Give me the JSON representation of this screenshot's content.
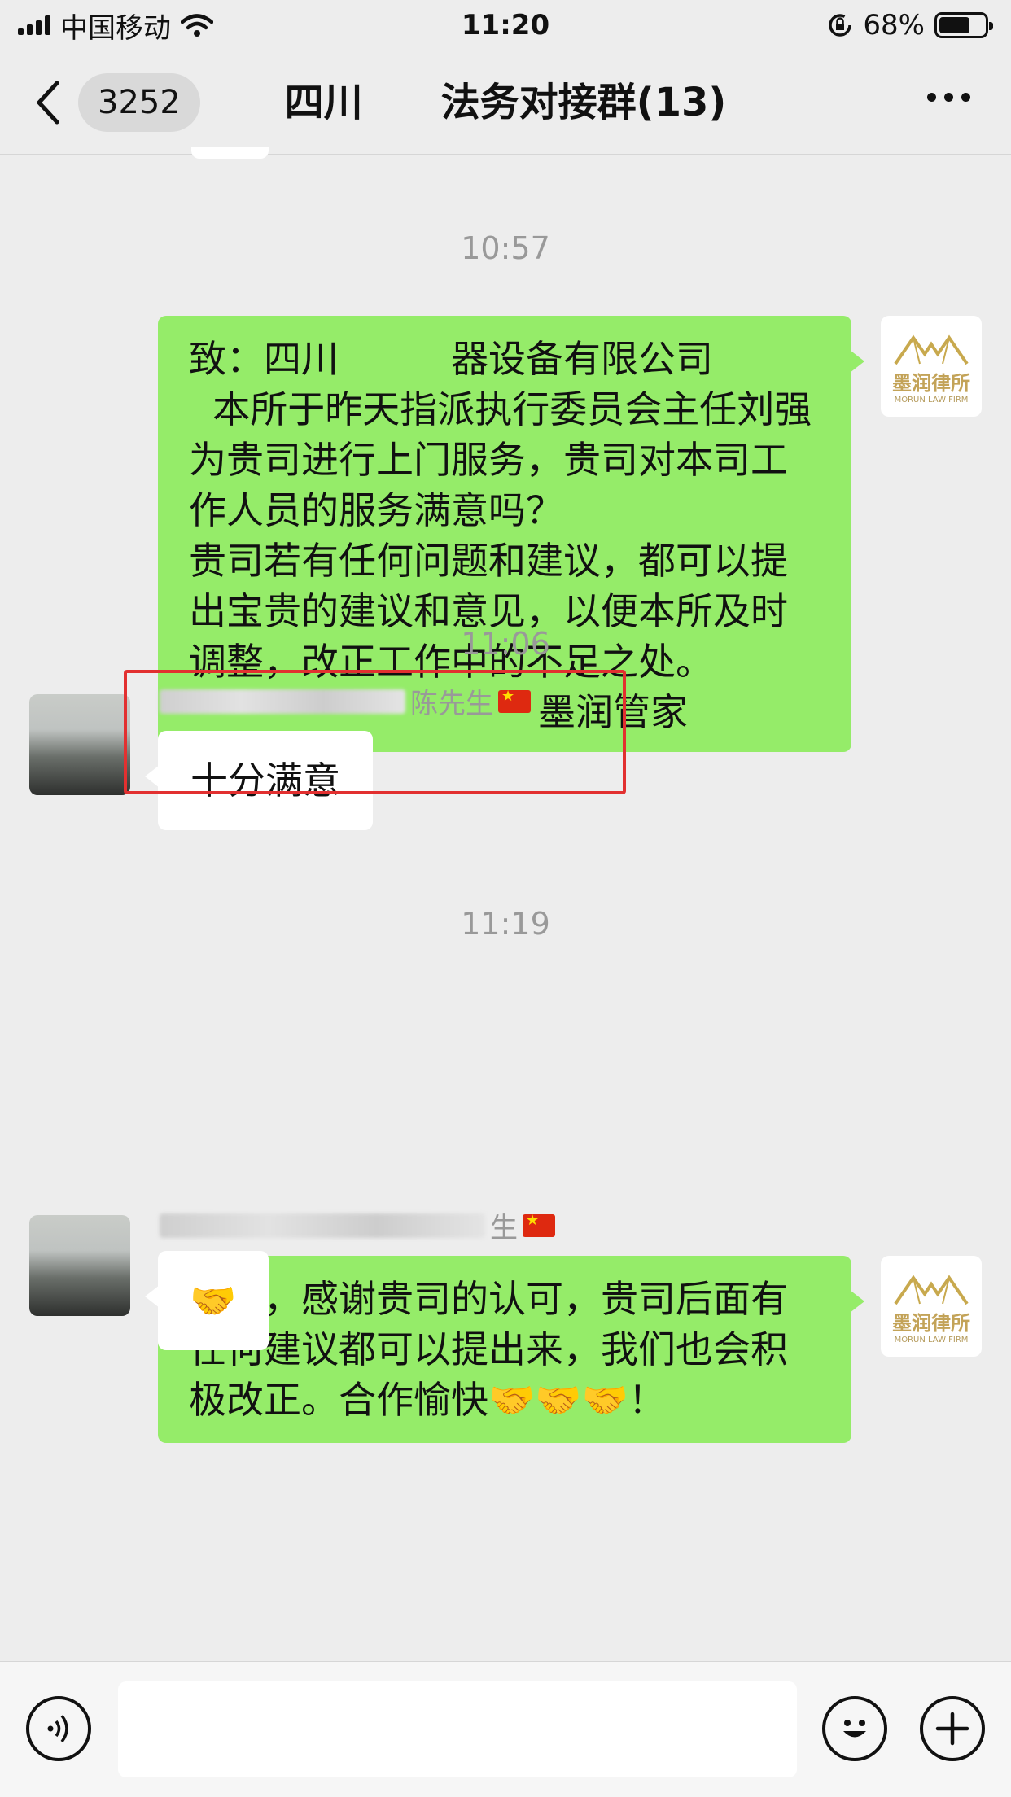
{
  "status_bar": {
    "carrier": "中国移动",
    "time": "11:20",
    "battery": "68%",
    "battery_level": 0.68
  },
  "nav": {
    "unread_count": "3252",
    "title": "四川　　法务对接群(13)"
  },
  "messages": [
    {
      "type": "time",
      "text": "10:57"
    },
    {
      "type": "outgoing",
      "sender_logo": {
        "name": "墨润律所",
        "sub": "MORUN LAW FIRM"
      },
      "text": "致：四川　　　器设备有限公司\n  本所于昨天指派执行委员会主任刘强为贵司进行上门服务，贵司对本司工作人员的服务满意吗？\n贵司若有任何问题和建议，都可以提出宝贵的建议和意见，以便本所及时调整，改正工作中的不足之处。",
      "signature": "墨润管家"
    },
    {
      "type": "time",
      "text": "11:06"
    },
    {
      "type": "incoming",
      "sender": "陈先生",
      "text": "十分满意",
      "highlighted": true
    },
    {
      "type": "time",
      "text": "11:19"
    },
    {
      "type": "outgoing",
      "sender_logo": {
        "name": "墨润律所",
        "sub": "MORUN LAW FIRM"
      },
      "text": "收到，感谢贵司的认可，贵司后面有任何建议都可以提出来，我们也会积极改正。合作愉快🤝🤝🤝！"
    },
    {
      "type": "incoming",
      "sender": "生",
      "text": "🤝"
    }
  ],
  "colors": {
    "outgoing_bubble": "#95ec69",
    "incoming_bubble": "#ffffff",
    "highlight_border": "#e23030",
    "background": "#ededed"
  },
  "icons": [
    "signal-icon",
    "wifi-icon",
    "lock-rotation-icon",
    "battery-icon",
    "back-chevron-icon",
    "more-icon",
    "voice-icon",
    "emoji-icon",
    "plus-icon",
    "china-flag-icon"
  ]
}
